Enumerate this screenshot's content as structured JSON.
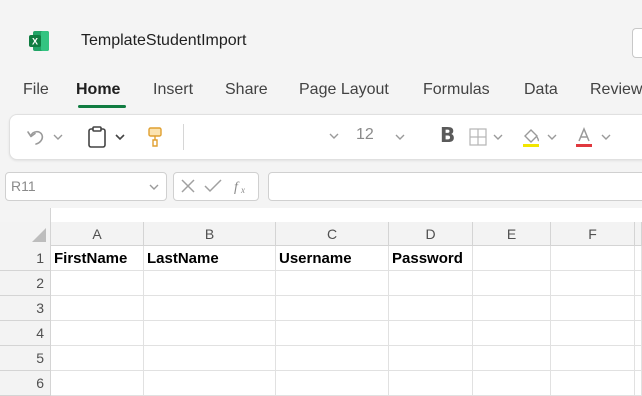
{
  "window": {
    "title": "TemplateStudentImport",
    "app_icon": "excel-icon",
    "brand_color": "#107c41"
  },
  "ribbon": {
    "tabs": [
      {
        "label": "File"
      },
      {
        "label": "Home",
        "active": true
      },
      {
        "label": "Insert"
      },
      {
        "label": "Share"
      },
      {
        "label": "Page Layout"
      },
      {
        "label": "Formulas"
      },
      {
        "label": "Data"
      },
      {
        "label": "Review"
      }
    ]
  },
  "toolbar": {
    "undo_icon": "undo-icon",
    "paste_icon": "clipboard-icon",
    "format_painter_icon": "format-painter-icon",
    "font_name": "",
    "font_size": "12",
    "bold_label": "B",
    "borders_icon": "borders-icon",
    "fill_color_icon": "fill-color-icon",
    "fill_color": "#f2e600",
    "font_color_icon": "font-color-icon",
    "font_color": "#e0383e"
  },
  "formula_bar": {
    "name_box": "R11",
    "cancel_icon": "cancel-icon",
    "enter_icon": "checkmark-icon",
    "fx_icon": "function-icon",
    "formula": ""
  },
  "sheet": {
    "columns": [
      "A",
      "B",
      "C",
      "D",
      "E",
      "F"
    ],
    "rows": [
      "1",
      "2",
      "3",
      "4",
      "5",
      "6"
    ],
    "cells": {
      "A1": "FirstName",
      "B1": "LastName",
      "C1": "Username",
      "D1": "Password"
    }
  }
}
